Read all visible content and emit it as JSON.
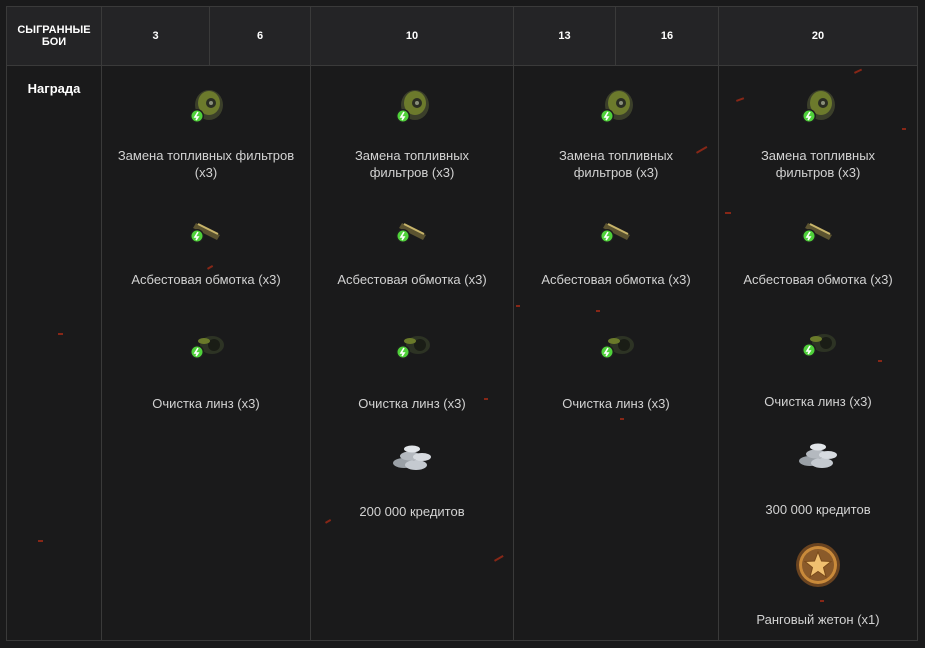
{
  "header": {
    "first_col": "СЫГРАННЫЕ БОИ",
    "battles": [
      "3",
      "6",
      "10",
      "13",
      "16",
      "20"
    ]
  },
  "row_label": "Награда",
  "rewards": {
    "col1": {
      "fuel": "Замена топливных фильтров (х3)",
      "asbestos": "Асбестовая обмотка (х3)",
      "lens": "Очистка линз (х3)"
    },
    "col2": {
      "fuel": "Замена топливных фильтров (х3)",
      "asbestos": "Асбестовая обмотка (х3)",
      "lens": "Очистка линз (х3)",
      "credits": "200 000 кредитов"
    },
    "col3": {
      "fuel": "Замена топливных фильтров (х3)",
      "asbestos": "Асбестовая обмотка (х3)",
      "lens": "Очистка линз (х3)"
    },
    "col4": {
      "fuel": "Замена топливных фильтров (х3)",
      "asbestos": "Асбестовая обмотка (х3)",
      "lens": "Очистка линз (х3)",
      "credits": "300 000 кредитов",
      "token": "Ранговый жетон (х1)"
    }
  },
  "colors": {
    "background": "#1a1a1b",
    "header_bg": "#242426",
    "border": "#3a3a3a",
    "boost_green": "#4fd13a",
    "token_gold": "#c98a3a"
  }
}
